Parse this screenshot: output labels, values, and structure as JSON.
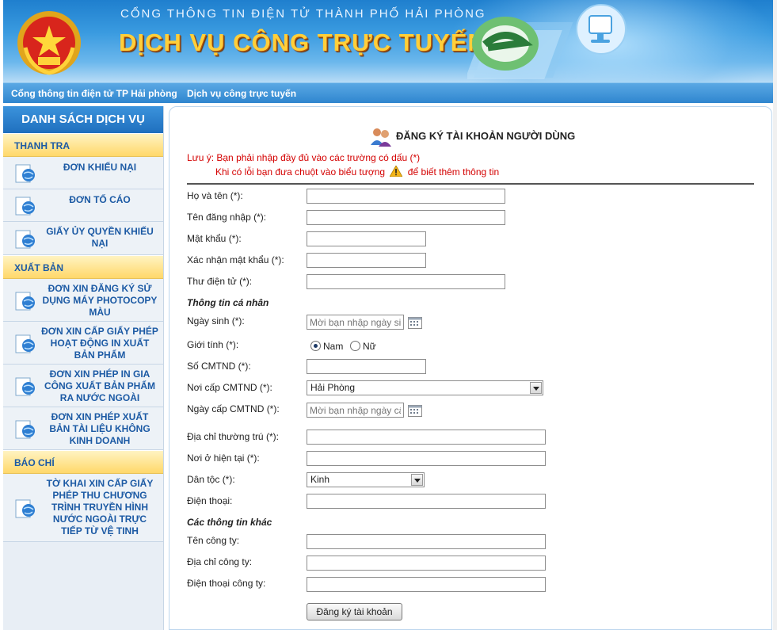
{
  "header": {
    "portal_title": "CỔNG THÔNG TIN ĐIỆN TỬ THÀNH PHỐ HẢI PHÒNG",
    "service_title": "DỊCH VỤ CÔNG TRỰC TUYẾN",
    "emblem_icon": "national-emblem-icon",
    "logo_icon": "e-government-logo-icon",
    "computer_icon": "computer-monitor-icon"
  },
  "topnav": {
    "portal_link": "Cổng thông tin điện tử TP Hải phòng",
    "dvc_link": "Dịch vụ công trực tuyến"
  },
  "sidebar": {
    "title": "DANH SÁCH DỊCH VỤ",
    "categories": [
      {
        "name": "THANH TRA",
        "items": [
          "ĐƠN KHIẾU NẠI",
          "ĐƠN TỐ CÁO",
          "GIẤY ỦY QUYỀN KHIẾU NẠI"
        ]
      },
      {
        "name": "XUẤT BẢN",
        "items": [
          "ĐƠN XIN ĐĂNG KÝ SỬ DỤNG MÁY PHOTOCOPY MÀU",
          "ĐƠN XIN CẤP GIẤY PHÉP HOẠT ĐỘNG IN XUẤT BẢN PHẨM",
          "ĐƠN XIN PHÉP IN GIA CÔNG XUẤT BẢN PHẨM RA NƯỚC NGOÀI",
          "ĐƠN XIN PHÉP XUẤT BẢN TÀI LIỆU KHÔNG KINH DOANH"
        ]
      },
      {
        "name": "BÁO CHÍ",
        "items": [
          "TỜ KHAI XIN CẤP GIẤY PHÉP THU CHƯƠNG TRÌNH TRUYỀN HÌNH NƯỚC NGOÀI TRỰC TIẾP TỪ VỆ TINH"
        ]
      }
    ],
    "item_icon": "document-globe-icon"
  },
  "form": {
    "title": "ĐĂNG KÝ TÀI KHOẢN NGƯỜI DÙNG",
    "note1": "Lưu ý: Bạn phải nhập đầy đủ vào các trường có dấu (*)",
    "note2_a": "Khi có lỗi bạn đưa chuột vào biểu tượng",
    "note2_b": "để biết thêm thông tin",
    "labels": {
      "full_name": "Họ và tên (*):",
      "username": "Tên đăng nhập (*):",
      "password": "Mật khẩu (*):",
      "confirm_password": "Xác nhận mật khẩu (*):",
      "email": "Thư điện tử (*):",
      "personal_section": "Thông tin cá nhân",
      "birth_date": "Ngày sinh (*):",
      "gender": "Giới tính (*):",
      "id_number": "Số CMTND (*):",
      "id_issue_place": "Nơi cấp CMTND (*):",
      "id_issue_date": "Ngày cấp CMTND (*):",
      "permanent_address": "Địa chỉ thường trú (*):",
      "current_address": "Nơi ở hiện tại (*):",
      "ethnicity": "Dân tộc (*):",
      "phone": "Điện thoại:",
      "other_section": "Các thông tin khác",
      "company_name": "Tên công ty:",
      "company_address": "Địa chỉ công ty:",
      "company_phone": "Điện thoại công ty:"
    },
    "values": {
      "full_name": "",
      "username": "",
      "password": "",
      "confirm_password": "",
      "email": "",
      "id_number": "",
      "permanent_address": "",
      "current_address": "",
      "phone": "",
      "company_name": "",
      "company_address": "",
      "company_phone": ""
    },
    "birth_date_placeholder": "Mời bạn nhập ngày sir",
    "id_issue_date_placeholder": "Mời bạn nhập ngày cấ",
    "gender_options": [
      "Nam",
      "Nữ"
    ],
    "gender_selected": "Nam",
    "id_issue_place_selected": "Hải Phòng",
    "ethnicity_selected": "Kinh",
    "submit_label": "Đăng ký tài khoản"
  }
}
